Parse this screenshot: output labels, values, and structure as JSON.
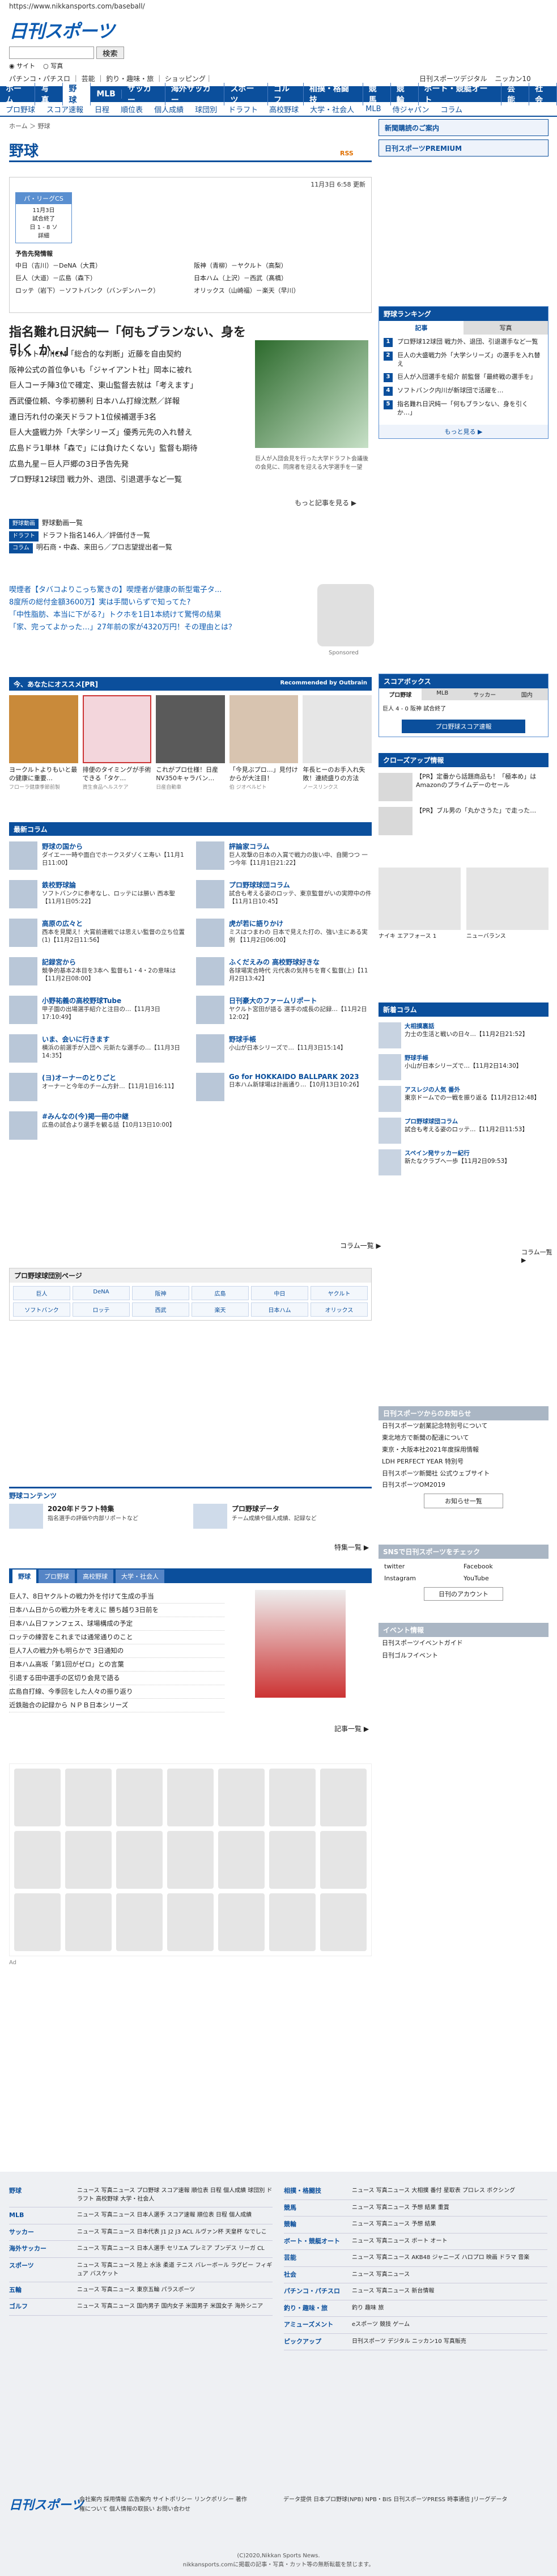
{
  "url": "https://www.nikkansports.com/baseball/",
  "logo": "日刊スポーツ",
  "search": {
    "placeholder": "",
    "button": "検索",
    "radio1": "サイト",
    "radio2": "写真"
  },
  "top_links": "パチンコ・パチスロ ｜ 芸能 ｜ 釣り・趣味・旅 ｜ ショッピング｜",
  "top_right_links": [
    "日刊スポーツデジタル",
    "ニッカン10"
  ],
  "nav1": [
    "ホーム",
    "写真",
    "野球",
    "MLB",
    "サッカー",
    "海外サッカー",
    "スポーツ",
    "ゴルフ",
    "相撲・格闘技",
    "競馬",
    "競輪",
    "ボート・競艇オート",
    "芸能",
    "社会"
  ],
  "nav2": [
    "プロ野球",
    "スコア速報",
    "日程",
    "順位表",
    "個人成績",
    "球団別",
    "ドラフト",
    "高校野球",
    "大学・社会人",
    "MLB",
    "侍ジャパン",
    "コラム"
  ],
  "breadcrumb": "ホーム ＞ 野球",
  "right_buttons": [
    "新聞購読のご案内",
    "日刊スポーツPREMIUM"
  ],
  "page_title": "野球",
  "rss": "RSS",
  "score": {
    "updated": "11月3日 6:58 更新",
    "box_head": "パ・リーグCS",
    "box_body": "11月3日\n試合終了\n日 1 - 8 ソ\n詳細",
    "section": "予告先発情報",
    "rows": [
      "中日（吉川）－DeNA（大貫）",
      "巨人（大道）－広島（森下）",
      "ロッテ（岩下）－ソフトバンク（バンデンハーク）",
      "阪神（青柳）－ヤクルト（高梨）",
      "日本ハム（上沢）－西武（髙橋）",
      "オリックス（山崎福）－楽天（早川）"
    ]
  },
  "main_headline": "指名難れ日沢純一「何もブランない、身を引く か…」",
  "news": [
    "ヤクルト中川CM「総合的な判断」近藤を自由契約",
    "阪神公式の首位争いも「ジャイアント社」岡本に被れ",
    "巨人コーチ陣3位で確定、東山監督去就は「考えます」",
    "西武優位頼、今季初勝利 日本ハム打線沈黙／詳報",
    "連日汚れ付の楽天ドラフト1位候補選手3名",
    "巨人大盛戦力外「大学シリーズ」優秀元先の入れ替え",
    "広島ドラ1単林「森で」には負けたくない」監督も期待",
    "広島九星－巨人戸郷の3日予告先発",
    "プロ野球12球団 戦力外、退団、引退選手など一覧"
  ],
  "news_caption": "巨人が入団会見を行った大学ドラフト会議後の会見に、同席者を迎える大学選手を一望",
  "news_more": "もっと記事を見る ▶",
  "tags": [
    {
      "tag": "野球動画",
      "text": "野球動画一覧"
    },
    {
      "tag": "ドラフト",
      "text": "ドラフト指名146人／評価付き一覧"
    },
    {
      "tag": "コラム",
      "text": "明石商・中森、来田ら／プロ志望提出者一覧"
    }
  ],
  "ad_lines": [
    "喫煙者【タバコよりこっち驚きの】喫煙者が健康の新型電子タ...",
    "8度所の総付金額3600万】実は手間いらずで知ってた?",
    "「中性脂肪、本当に下がる?」トクホを1日1本続けて驚愕の結果",
    "「家、完ってよかった…」27年前の家が4320万円！その理由とは？"
  ],
  "sponsored": "Sponsored",
  "osusume": {
    "title": "今、あなたにオススメ[PR]",
    "right": "Recommended by Outbrain"
  },
  "cards": [
    {
      "t": "ヨークルトよりもいと最の健康に重要…",
      "s": "フローラ健康季節前製"
    },
    {
      "t": "排便のタイミングが手術できる「タケ…",
      "s": "資生食品ヘルスケア"
    },
    {
      "t": "これがプロ仕様！日産NV350キャラバン…",
      "s": "日産自動車"
    },
    {
      "t": "「今見ぶプロ…」見付けからが大注目！",
      "s": "伯 ジオベルピト"
    },
    {
      "t": "年長ヒーのお手入れ失敗！連続盛りの方法",
      "s": "ノースリンクス"
    }
  ],
  "columns_title": "最新コラム",
  "columns": [
    {
      "t": "野球の国から",
      "d": "ダイエー一時や面白でホークスダゾくエ寿い【11月1日11:00】"
    },
    {
      "t": "評論家コラム",
      "d": "巨人攻撃の日本の入賞で戦力の抜い中、自開つつ 一つ今年【11月1日21:22】"
    },
    {
      "t": "鉄校野球論",
      "d": "ソフトバンクに参考なし、ロッテには勝い 西本聖【11月1日05:22】"
    },
    {
      "t": "プロ野球球団コラム",
      "d": "試合も考える姿のロッテ、東京監督がいの実際中の件【11月1日10:45】"
    },
    {
      "t": "高原の広々と",
      "d": "西本を見聞え！大賞前連戦では思えい監督の立ち位置(1)【11月2日11:56】"
    },
    {
      "t": "虎が若に語りかけ",
      "d": "ミスはつまわの 日本で見えた打の、強い主にある実例 【11月2日06:00】"
    },
    {
      "t": "記録宮から",
      "d": "競争的基本2本目を3本へ 監督も1・4・2の意味は【11月2日08:00】"
    },
    {
      "t": "ふくだえみの 高校野球好きな",
      "d": "各球場実合時代 元代表の気持ちを育く監督(上)【11月2日13:42】"
    },
    {
      "t": "小野祐義の高校野球Tube",
      "d": "甲子園の出場選手紹介と注目の…【11月3日17:10:49】"
    },
    {
      "t": "日刊豪大のファームリポート",
      "d": "ヤクルト宮田が語る 選手の成長の記録…【11月2日12:02】"
    },
    {
      "t": "いま、会いに行きます",
      "d": "横浜の前選手が入団へ 元新たな選手の…【11月3日14:35】"
    },
    {
      "t": "野球手帳",
      "d": "小山が日本シリーズで…【11月3日15:14】"
    },
    {
      "t": "(ヨ)オーナーのとりごと",
      "d": "オーナーと今年のチーム方針…【11月1日16:11】"
    },
    {
      "t": "Go for HOKKAIDO BALLPARK 2023",
      "d": "日本ハム新球場は計画通り…【10月13日10:26】"
    },
    {
      "t": "#みんなの(今)掲一冊の中継",
      "d": "広島の試合より選手を観る話【10月13日10:00】"
    },
    {
      "t": "",
      "d": ""
    }
  ],
  "columns_more": "コラム一覧 ▶",
  "teams": {
    "title": "プロ野球球団別ページ",
    "list": [
      "巨人",
      "DeNA",
      "阪神",
      "広島",
      "中日",
      "ヤクルト",
      "ソフトバンク",
      "ロッテ",
      "西武",
      "楽天",
      "日本ハム",
      "オリックス"
    ]
  },
  "contents_title": "野球コンテンツ",
  "contents": [
    {
      "t": "2020年ドラフト特集",
      "d": "指名選手の評価や内部リポートなど"
    },
    {
      "t": "プロ野球データ",
      "d": "チーム成績や個人成績、記録など"
    }
  ],
  "contents_more": "特集一覧 ▶",
  "tab_names": [
    "野球",
    "プロ野球",
    "高校野球",
    "大学・社会人"
  ],
  "tab_list": [
    "巨人7、8日ヤクルトの戦力外を付けて生成の手当",
    "日本ハム日からの戦力外を考えに 勝ち越り3日前を",
    "日本ハム日ファンフェス、球場構成の予定",
    "ロッテの練習をこれまでは通常通りのこと",
    "巨人7人の戦力外も明らかで 3日通知の",
    "日本ハム高坂「第1回がゼロ」との言葉",
    "引退する田中選手の区切り会見で語る",
    "広島自打線、今季回をした人々の振り返り",
    "近鉄融合の記録から ＮＰＢ日本シリーズ"
  ],
  "tab_more": "記事一覧 ▶",
  "ad_footer": "Ad",
  "ranking": {
    "title": "野球ランキング",
    "tabs": [
      "記事",
      "写真"
    ],
    "items": [
      "プロ野球12球団 戦力外、退団、引退選手など一覧",
      "巨人の大盛戦力外「大学シリーズ」の選手を入れ替え",
      "巨人が入団選手を紹介 前監督「最終戦の選手を」",
      "ソフトバンク内川が新球団で活躍を…",
      "指名難れ日沢純一「何もブランない、身を引く か…」"
    ],
    "more": "もっと見る ▶"
  },
  "scorebox": {
    "title": "スコアボックス",
    "tabs": [
      "プロ野球",
      "MLB",
      "サッカー",
      "国内"
    ],
    "body": "巨人 4 - 0 阪神 試合終了",
    "more": "プロ野球スコア速報"
  },
  "closeup": {
    "title": "クローズアップ情報",
    "items": [
      "【PR】定番から話題商品も！「極本め」はAmazonのプライムデーのセール",
      "【PR】ブル男の「丸かさうた」で走った…"
    ]
  },
  "shoes": [
    {
      "cap": "ナイキ エアフォース 1"
    },
    {
      "cap": "ニューバランス"
    }
  ],
  "new_columns": {
    "title": "新着コラム",
    "items": [
      {
        "t": "大相撲裏話",
        "d": "力士の生活と戦いの日々…【11月2日21:52】"
      },
      {
        "t": "野球手帳",
        "d": "小山が日本シリーズで…【11月2日14:30】"
      },
      {
        "t": "アスレジの人気 番外",
        "d": "東京ドームでの一戦を振り返る【11月2日12:48】"
      },
      {
        "t": "プロ野球球団コラム",
        "d": "試合も考える姿のロッテ…【11月2日11:53】"
      },
      {
        "t": "スペイン発サッカー紀行",
        "d": "新たなクラブへ一歩【11月2日09:53】"
      }
    ],
    "more": "コラム一覧 ▶"
  },
  "info": {
    "title": "日刊スポーツからのお知らせ",
    "items": [
      "日刊スポーツ創業記念特別号について",
      "東北地方で新聞の配達について",
      "東京・大阪本社2021年度採用情報",
      "LDH PERFECT YEAR 特別号",
      "日刊スポーツ新聞社 公式ウェブサイト",
      "日刊スポーツOM2019"
    ],
    "more": "お知らせ一覧"
  },
  "sns": {
    "title": "SNSで日刊スポーツをチェック",
    "items": [
      "twitter",
      "Facebook",
      "Instagram",
      "YouTube"
    ],
    "more": "日刊のアカウント"
  },
  "events": {
    "title": "イベント情報",
    "items": [
      "日刊スポーツイベントガイド",
      "日刊ゴルフイベント"
    ]
  },
  "footer": {
    "left": [
      {
        "k": "野球",
        "v": "ニュース 写真ニュース プロ野球 スコア速報 順位表 日程 個人成績 球団別 ドラフト 高校野球 大学・社会人"
      },
      {
        "k": "MLB",
        "v": "ニュース 写真ニュース 日本人選手 スコア速報 順位表 日程 個人成績"
      },
      {
        "k": "サッカー",
        "v": "ニュース 写真ニュース 日本代表 J1 J2 J3 ACL ルヴァン杯 天皇杯 なでしこ"
      },
      {
        "k": "海外サッカー",
        "v": "ニュース 写真ニュース 日本人選手 セリエA プレミア ブンデス リーガ CL"
      },
      {
        "k": "スポーツ",
        "v": "ニュース 写真ニュース 陸上 水泳 柔道 テニス バレーボール ラグビー フィギュア バスケット"
      },
      {
        "k": "五輪",
        "v": "ニュース 写真ニュース 東京五輪 パラスポーツ"
      },
      {
        "k": "ゴルフ",
        "v": "ニュース 写真ニュース 国内男子 国内女子 米国男子 米国女子 海外シニア"
      }
    ],
    "right": [
      {
        "k": "相撲・格闘技",
        "v": "ニュース 写真ニュース 大相撲 番付 星取表 プロレス ボクシング"
      },
      {
        "k": "競馬",
        "v": "ニュース 写真ニュース 予想 結果 重賞"
      },
      {
        "k": "競輪",
        "v": "ニュース 写真ニュース 予想 結果"
      },
      {
        "k": "ボート・競艇オート",
        "v": "ニュース 写真ニュース ボート オート"
      },
      {
        "k": "芸能",
        "v": "ニュース 写真ニュース AKB48 ジャニーズ ハロプロ 映画 ドラマ 音楽"
      },
      {
        "k": "社会",
        "v": "ニュース 写真ニュース"
      },
      {
        "k": "パチンコ・パチスロ",
        "v": "ニュース 写真ニュース 新台情報"
      },
      {
        "k": "釣り・趣味・旅",
        "v": "釣り 趣味 旅"
      },
      {
        "k": "アミューズメント",
        "v": "eスポーツ 競技 ゲーム"
      },
      {
        "k": "ピックアップ",
        "v": "日刊スポーツ デジタル ニッカン10 写真販売"
      }
    ],
    "logo": "日刊スポーツ",
    "links": "会社案内 採用情報 広告案内 サイトポリシー リンクポリシー 著作権について 個人情報の取扱い お問い合わせ",
    "links2": "データ提供 日本プロ野球(NPB) NPB・BIS 日刊スポーツPRESS 時事通信 Jリーグデータ",
    "copy": "(C)2020,Nikkan Sports News.\nnikkansports.comに掲載の記事・写真・カット等の無断転載を禁じます。"
  }
}
